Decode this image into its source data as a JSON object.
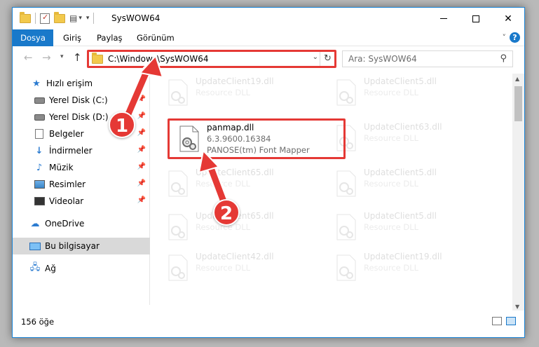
{
  "window": {
    "title": "SysWOW64"
  },
  "ribbon": {
    "tabs": [
      "Dosya",
      "Giriş",
      "Paylaş",
      "Görünüm"
    ]
  },
  "nav": {
    "address": "C:\\Windows\\SysWOW64",
    "search_placeholder": "Ara: SysWOW64"
  },
  "sidebar": {
    "quick_access": "Hızlı erişim",
    "items": [
      {
        "label": "Yerel Disk (C:)",
        "icon": "drive-icon"
      },
      {
        "label": "Yerel Disk (D:)",
        "icon": "drive-icon"
      },
      {
        "label": "Belgeler",
        "icon": "documents-icon"
      },
      {
        "label": "İndirmeler",
        "icon": "downloads-icon"
      },
      {
        "label": "Müzik",
        "icon": "music-icon"
      },
      {
        "label": "Resimler",
        "icon": "pictures-icon"
      },
      {
        "label": "Videolar",
        "icon": "videos-icon"
      }
    ],
    "onedrive": "OneDrive",
    "this_pc": "Bu bilgisayar",
    "network": "Ağ"
  },
  "files": {
    "selected": {
      "name": "panmap.dll",
      "version": "6.3.9600.16384",
      "description": "PANOSE(tm) Font Mapper"
    },
    "background": [
      {
        "name": "UpdateClient19.dll",
        "type": "Resource DLL"
      },
      {
        "name": "UpdateClient5.dll",
        "type": "Resource DLL"
      },
      {
        "name": "UpdateClient63.dll",
        "type": "Resource DLL"
      },
      {
        "name": "UpdateClient65.dll",
        "type": "Resource DLL"
      },
      {
        "name": "UpdateClient5.dll",
        "type": "Resource DLL"
      },
      {
        "name": "UpdateClient65.dll",
        "type": "Resource DLL"
      },
      {
        "name": "UpdateClient5.dll",
        "type": "Resource DLL"
      },
      {
        "name": "UpdateClient42.dll",
        "type": "Resource DLL"
      },
      {
        "name": "UpdateClient19.dll",
        "type": "Resource DLL"
      }
    ]
  },
  "status": {
    "count": "156 öğe"
  },
  "callouts": {
    "step1": "1",
    "step2": "2"
  },
  "colors": {
    "accent": "#1979ca",
    "highlight": "#e53935"
  }
}
